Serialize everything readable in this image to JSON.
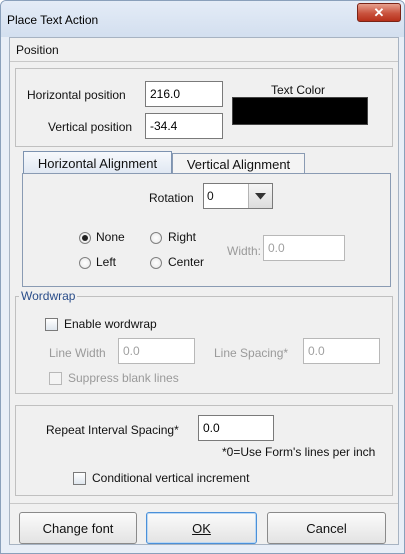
{
  "window": {
    "title": "Place Text Action",
    "close_glyph": "✕"
  },
  "menu": {
    "position": "Position"
  },
  "position": {
    "horizontal_label": "Horizontal position",
    "horizontal_value": "216.0",
    "vertical_label": "Vertical position",
    "vertical_value": "-34.4",
    "text_color_label": "Text Color",
    "text_color": "#000000"
  },
  "tabs": [
    {
      "label": "Horizontal Alignment",
      "active": true
    },
    {
      "label": "Vertical Alignment",
      "active": false
    }
  ],
  "alignment": {
    "rotation_label": "Rotation",
    "rotation_value": "0",
    "radios": [
      {
        "label": "None",
        "checked": true
      },
      {
        "label": "Right",
        "checked": false
      },
      {
        "label": "Left",
        "checked": false
      },
      {
        "label": "Center",
        "checked": false
      }
    ],
    "width_label": "Width:",
    "width_value": "0.0"
  },
  "wordwrap": {
    "title": "Wordwrap",
    "enable_label": "Enable wordwrap",
    "line_width_label": "Line Width",
    "line_width_value": "0.0",
    "line_spacing_label": "Line Spacing*",
    "line_spacing_value": "0.0",
    "suppress_label": "Suppress blank lines"
  },
  "repeat": {
    "label": "Repeat Interval Spacing*",
    "value": "0.0",
    "note": "*0=Use Form's lines per inch",
    "conditional_label": "Conditional vertical increment"
  },
  "buttons": {
    "change_font": "Change font",
    "ok": "OK",
    "cancel": "Cancel"
  }
}
